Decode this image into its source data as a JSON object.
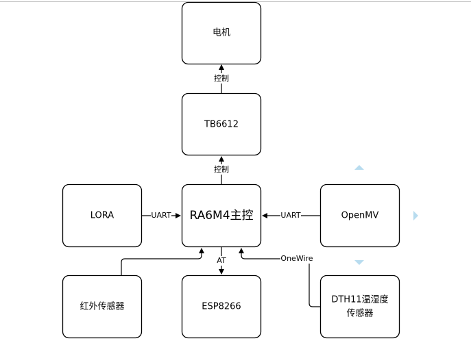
{
  "nodes": {
    "motor": "电机",
    "driver": "TB6612",
    "main": "RA6M4主控",
    "lora": "LORA",
    "openmv": "OpenMV",
    "infrared": "红外传感器",
    "esp": "ESP8266",
    "dth_line1": "DTH11温湿度",
    "dth_line2": "传感器"
  },
  "edges": {
    "driver_to_motor": "控制",
    "main_to_driver": "控制",
    "lora_to_main": "UART",
    "openmv_to_main": "UART",
    "main_to_esp": "AT",
    "dth_to_main": "OneWire"
  },
  "colors": {
    "hover_arrow": "#b8dcef",
    "border_line": "#c0c0c0"
  }
}
